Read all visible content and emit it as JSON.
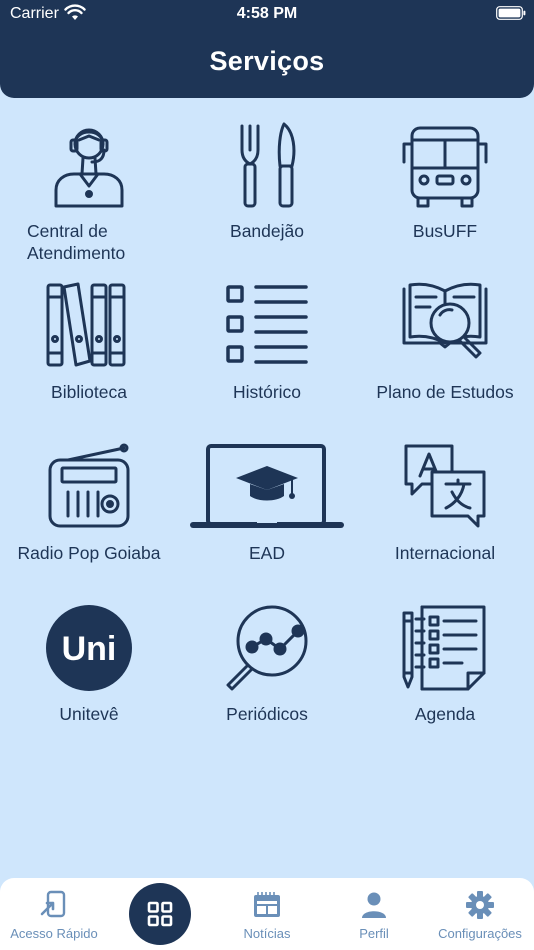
{
  "status_bar": {
    "carrier": "Carrier",
    "time": "4:58 PM"
  },
  "header": {
    "title": "Serviços"
  },
  "services": [
    {
      "label": "Central de\nAtendimento",
      "icon": "headset-agent-icon"
    },
    {
      "label": "Bandejão",
      "icon": "fork-knife-icon"
    },
    {
      "label": "BusUFF",
      "icon": "bus-icon"
    },
    {
      "label": "Biblioteca",
      "icon": "books-icon"
    },
    {
      "label": "Histórico",
      "icon": "checklist-icon"
    },
    {
      "label": "Plano de Estudos",
      "icon": "book-magnifier-icon"
    },
    {
      "label": "Radio Pop Goiaba",
      "icon": "radio-icon"
    },
    {
      "label": "EAD",
      "icon": "laptop-graduation-icon"
    },
    {
      "label": "Internacional",
      "icon": "translate-icon"
    },
    {
      "label": "Unitevê",
      "icon": "unitv-logo-icon"
    },
    {
      "label": "Periódicos",
      "icon": "magnifier-chart-icon"
    },
    {
      "label": "Agenda",
      "icon": "notepad-pencil-icon"
    }
  ],
  "tabbar": {
    "items": [
      {
        "label": "Acesso Rápido",
        "icon": "quick-access-icon"
      },
      {
        "label": "",
        "icon": "grid-icon"
      },
      {
        "label": "Notícias",
        "icon": "newspaper-icon"
      },
      {
        "label": "Perfil",
        "icon": "person-icon"
      },
      {
        "label": "Configurações",
        "icon": "gear-icon"
      }
    ]
  },
  "colors": {
    "navy": "#1e3556",
    "background": "#cfe6fc",
    "tab_inactive": "#6a8fb8",
    "logo_text": "Uni"
  }
}
